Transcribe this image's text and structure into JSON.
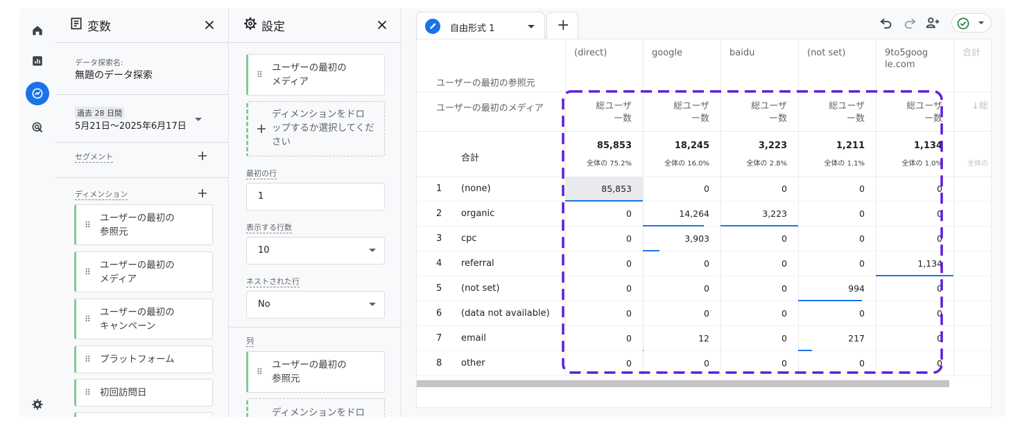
{
  "variables_panel": {
    "title": "変数",
    "exploration_name_label": "データ探索名:",
    "exploration_name": "無題のデータ探索",
    "date_range_label": "過去 28 日間",
    "date_range": "5月21日～2025年6月17日",
    "segments_label": "セグメント",
    "dimensions_label": "ディメンション",
    "dimensions": [
      [
        "ユーザーの最初の",
        "参照元"
      ],
      [
        "ユーザーの最初の",
        "メディア"
      ],
      [
        "ユーザーの最初の",
        "キャンペーン"
      ],
      [
        "プラットフォーム"
      ],
      [
        "初回訪問日"
      ]
    ]
  },
  "settings_panel": {
    "title": "設定",
    "rows_chip": [
      "ユーザーの最初の",
      "メディア"
    ],
    "drop_hint": [
      "ディメンションをドロ",
      "ップするか選択してくだ",
      "さい"
    ],
    "start_row_label": "最初の行",
    "start_row_value": "1",
    "rows_to_show_label": "表示する行数",
    "rows_to_show_value": "10",
    "nested_rows_label": "ネストされた行",
    "nested_rows_value": "No",
    "columns_label": "列",
    "columns_chip": [
      "ユーザーの最初の",
      "参照元"
    ],
    "columns_drop_hint": "ディメンションをドロ"
  },
  "tab": {
    "label": "自由形式 1",
    "add_label": "+"
  },
  "table": {
    "column_dimension_label": "ユーザーの最初の参照元",
    "row_dimension_label": "ユーザーの最初のメディア",
    "columns": [
      [
        "(direct)"
      ],
      [
        "google"
      ],
      [
        "baidu"
      ],
      [
        "(not set)"
      ],
      [
        "9to5goog",
        "le.com"
      ],
      [
        "合計"
      ]
    ],
    "metric_label": [
      "総ユーザ",
      "ー数"
    ],
    "metric_label_faded": "↓総",
    "totals_label": "合計",
    "totals": [
      "85,853",
      "18,245",
      "3,223",
      "1,211",
      "1,134"
    ],
    "totals_pct": [
      "全体の 75.2%",
      "全体の 16.0%",
      "全体の 2.8%",
      "全体の 1.1%",
      "全体の 1.0%"
    ],
    "totals_pct_faded": "全体の",
    "rows": [
      {
        "idx": "1",
        "label": "(none)",
        "values": [
          "85,853",
          "0",
          "0",
          "0",
          "0"
        ]
      },
      {
        "idx": "2",
        "label": "organic",
        "values": [
          "0",
          "14,264",
          "3,223",
          "0",
          "0"
        ]
      },
      {
        "idx": "3",
        "label": "cpc",
        "values": [
          "0",
          "3,903",
          "0",
          "0",
          "0"
        ]
      },
      {
        "idx": "4",
        "label": "referral",
        "values": [
          "0",
          "0",
          "0",
          "0",
          "1,134"
        ]
      },
      {
        "idx": "5",
        "label": "(not set)",
        "values": [
          "0",
          "0",
          "0",
          "994",
          "0"
        ]
      },
      {
        "idx": "6",
        "label": "(data not available)",
        "values": [
          "0",
          "0",
          "0",
          "0",
          "0"
        ]
      },
      {
        "idx": "7",
        "label": "email",
        "values": [
          "0",
          "12",
          "0",
          "217",
          "0"
        ]
      },
      {
        "idx": "8",
        "label": "other",
        "values": [
          "0",
          "0",
          "0",
          "0",
          "0"
        ]
      }
    ]
  },
  "annotation": {
    "color": "#5b1fd6"
  },
  "colors": {
    "accent": "#1a73e8",
    "chip_border": "#81c995",
    "status_ok": "#188038"
  }
}
